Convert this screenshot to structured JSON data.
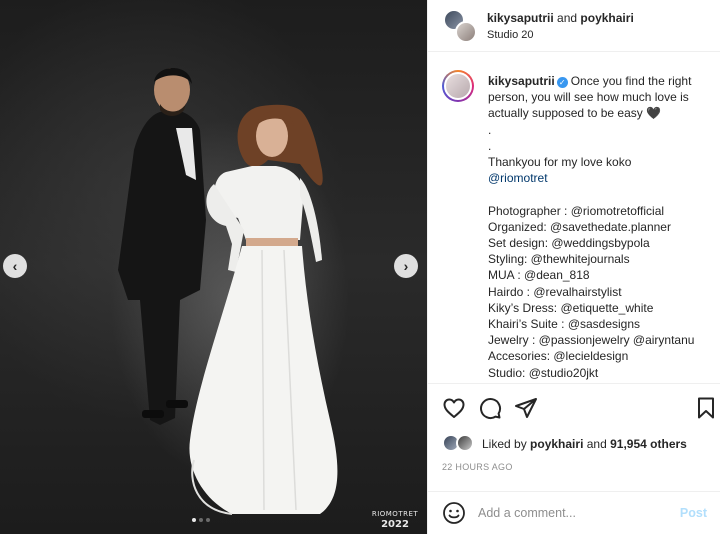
{
  "header": {
    "user1": "kikysaputrii",
    "and": "and",
    "user2": "poykhairi",
    "location": "Studio 20"
  },
  "photo": {
    "watermark_name": "RIOMOTRET",
    "watermark_year": "2022",
    "prev_icon": "chevron-left-icon",
    "next_icon": "chevron-right-icon"
  },
  "caption": {
    "username": "kikysaputrii",
    "lines": [
      "Once you find the right",
      "person, you will see how much love is",
      "actually supposed to be easy 🖤",
      ".",
      ".",
      "Thankyou for my love koko",
      "@riomotret",
      "",
      "Photographer : @riomotretofficial",
      "Organized: @savethedate.planner",
      "Set design: @weddingsbypola",
      "Styling: @thewhitejournals",
      "MUA : @dean_818",
      "Hairdo : @revalhairstylist",
      "Kiky’s Dress: @etiquette_white",
      "Khairi’s Suite : @sasdesigns",
      "Jewelry : @passionjewelry @airyntanu",
      "Accesories: @lecieldesign",
      "Studio: @studio20jkt"
    ]
  },
  "actions": {
    "like_icon": "heart-icon",
    "comment_icon": "comment-icon",
    "share_icon": "paper-plane-icon",
    "save_icon": "bookmark-icon"
  },
  "likes": {
    "prefix": "Liked by",
    "user": "poykhairi",
    "and": "and",
    "count": "91,954 others"
  },
  "time": "22 HOURS AGO",
  "comment": {
    "placeholder": "Add a comment...",
    "post_label": "Post"
  }
}
